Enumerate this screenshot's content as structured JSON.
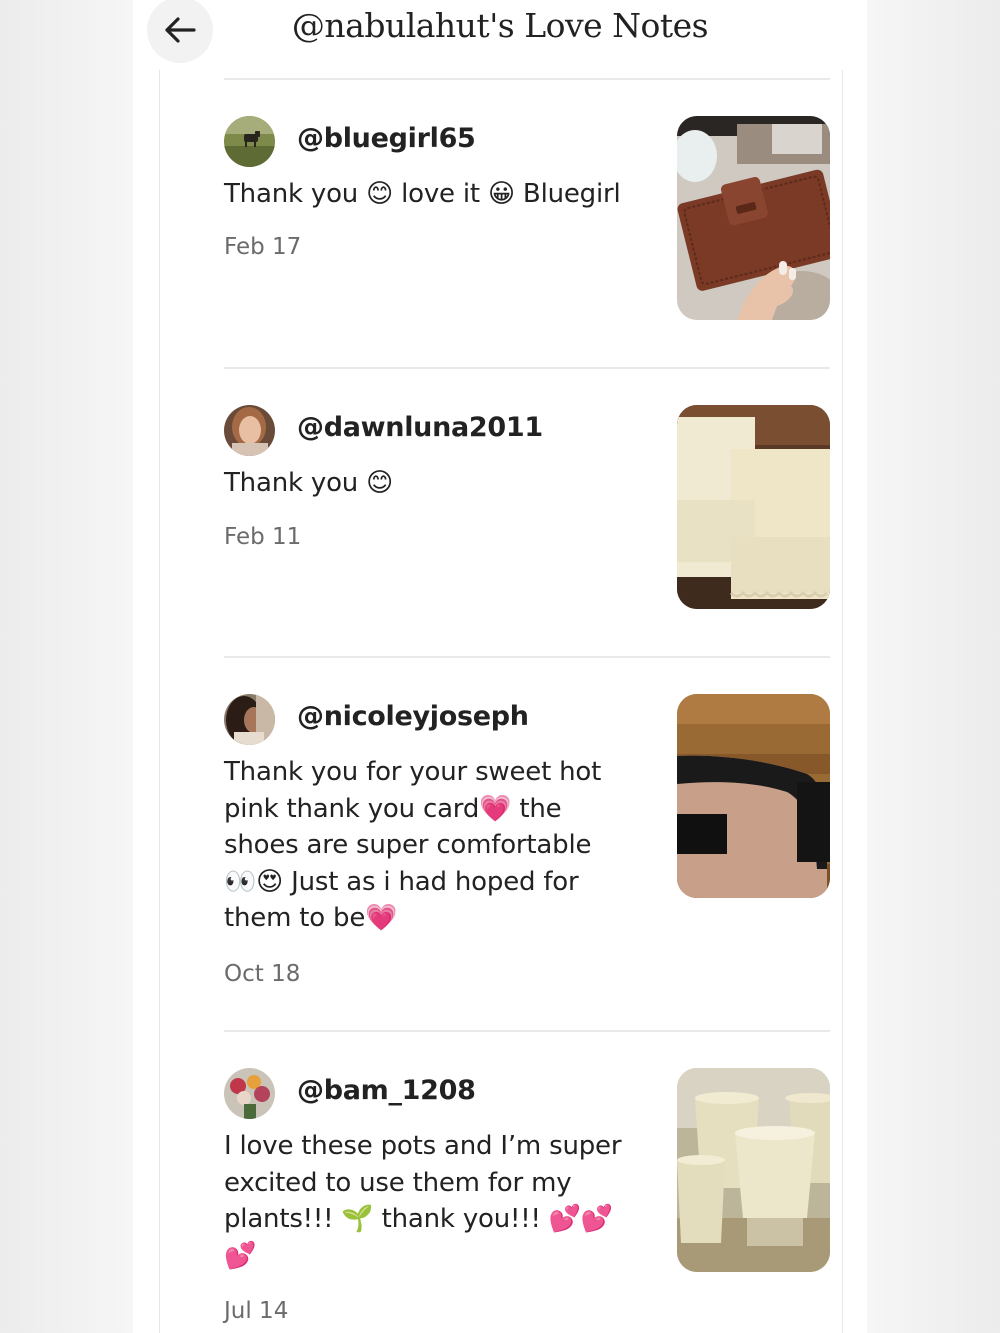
{
  "header": {
    "title": "@nabulahut's Love Notes",
    "back_icon": "arrow-left-icon"
  },
  "notes": [
    {
      "username": "@bluegirl65",
      "message": "Thank you 😊 love it 😀 Bluegirl",
      "date": "Feb 17",
      "avatar": "cow-in-field-avatar",
      "photo": "brown-wallet-photo"
    },
    {
      "username": "@dawnluna2011",
      "message": "Thank you 😊",
      "date": "Feb 11",
      "avatar": "woman-portrait-avatar",
      "photo": "cream-lace-pillowcases-photo"
    },
    {
      "username": "@nicoleyjoseph",
      "message": "Thank you for your sweet hot pink thank you card💗 the shoes are super comfortable 👀😍 Just as i had hoped for them to be💗",
      "date": "Oct 18",
      "avatar": "woman-selfie-avatar",
      "photo": "black-sandal-photo"
    },
    {
      "username": "@bam_1208",
      "message": "I love these pots and I’m super excited to use them for my plants!!! 🌱 thank you!!! 💕💕 💕",
      "date": "Jul 14",
      "avatar": "flower-bouquet-avatar",
      "photo": "white-plant-pots-photo"
    }
  ]
}
